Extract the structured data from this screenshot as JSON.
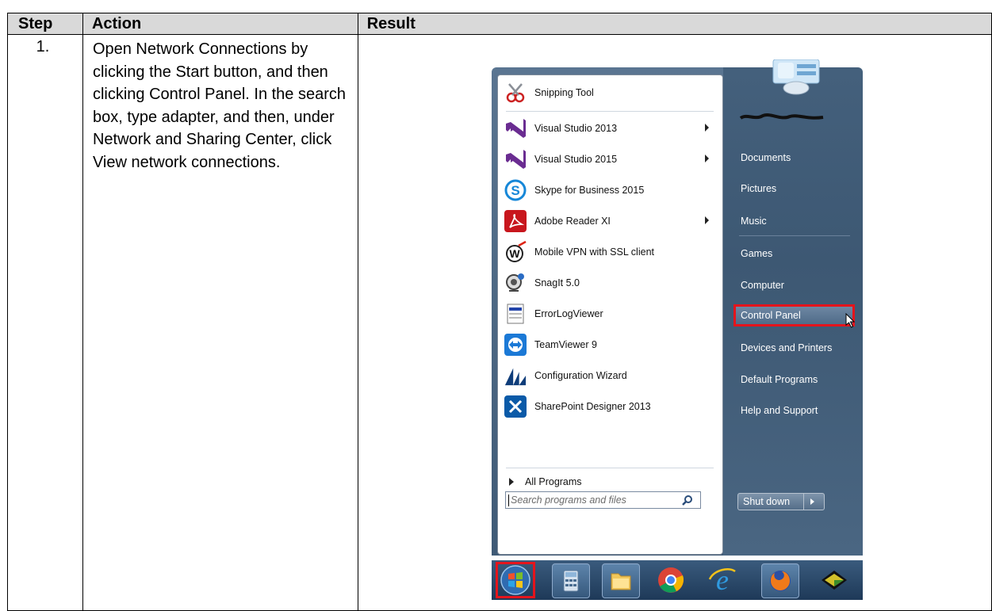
{
  "table": {
    "headers": [
      "Step",
      "Action",
      "Result"
    ],
    "row": {
      "step": "1.",
      "action": "Open Network Connections by clicking the Start button, and then clicking Control Panel. In the search box, type adapter, and then, under Network and Sharing Center, click View network connections."
    }
  },
  "start_menu": {
    "programs": [
      {
        "label": "Snipping Tool",
        "icon": "snipping-tool-icon"
      },
      {
        "label": "Visual Studio 2013",
        "icon": "visual-studio-icon",
        "submenu": true
      },
      {
        "label": "Visual Studio 2015",
        "icon": "visual-studio-icon",
        "submenu": true
      },
      {
        "label": "Skype for Business 2015",
        "icon": "skype-icon"
      },
      {
        "label": "Adobe Reader XI",
        "icon": "adobe-reader-icon",
        "submenu": true
      },
      {
        "label": "Mobile VPN with SSL client",
        "icon": "watchguard-icon"
      },
      {
        "label": "SnagIt 5.0",
        "icon": "snagit-icon"
      },
      {
        "label": "ErrorLogViewer",
        "icon": "log-viewer-icon"
      },
      {
        "label": "TeamViewer 9",
        "icon": "teamviewer-icon"
      },
      {
        "label": "Configuration Wizard",
        "icon": "dynamics-icon"
      },
      {
        "label": "SharePoint Designer 2013",
        "icon": "sharepoint-designer-icon"
      }
    ],
    "all_programs": "All Programs",
    "search_placeholder": "Search programs and files",
    "places": [
      "Documents",
      "Pictures",
      "Music",
      "Games",
      "Computer",
      "Control Panel",
      "Devices and Printers",
      "Default Programs",
      "Help and Support"
    ],
    "shutdown": "Shut down"
  },
  "colors": {
    "highlight": "#e4141c",
    "header_bg": "#d9d9d9"
  }
}
